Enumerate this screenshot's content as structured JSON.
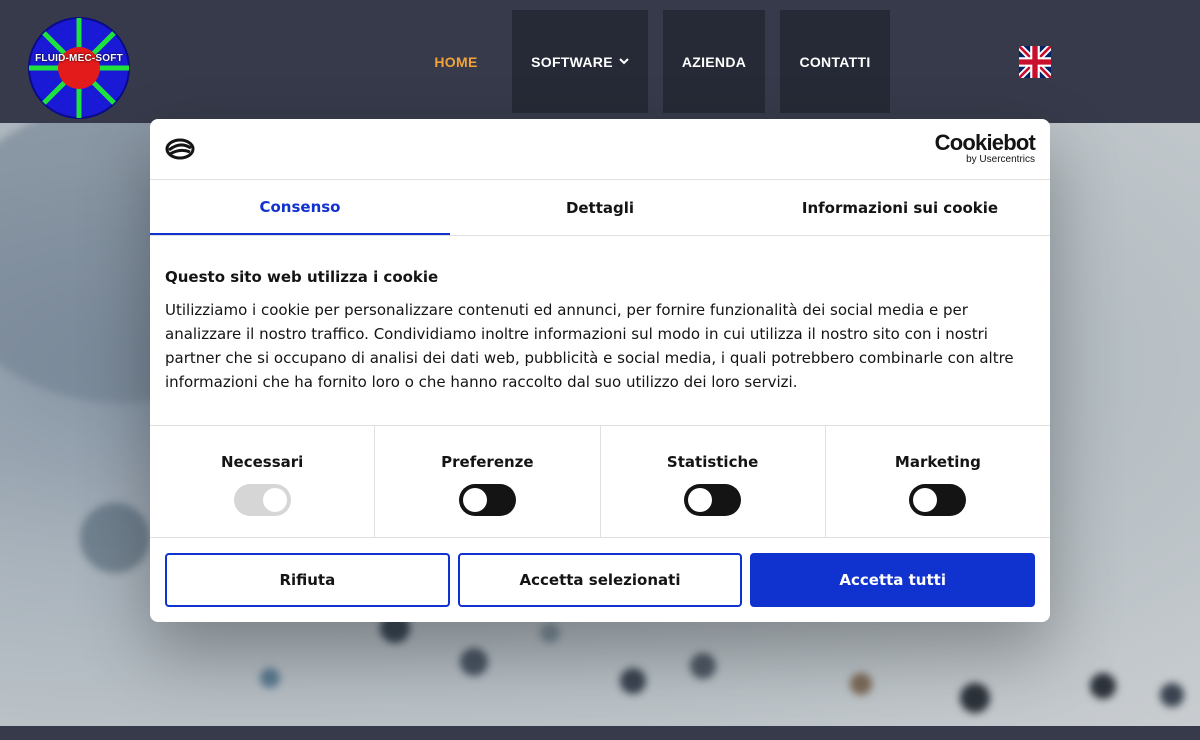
{
  "site": {
    "logo_text": "FLUID-MEC-SOFT",
    "nav": {
      "home": "HOME",
      "software": "SOFTWARE",
      "azienda": "AZIENDA",
      "contatti": "CONTATTI"
    }
  },
  "cookie_dialog": {
    "brand": {
      "name": "Cookiebot",
      "byline": "by Usercentrics"
    },
    "tabs": [
      {
        "label": "Consenso",
        "active": true
      },
      {
        "label": "Dettagli",
        "active": false
      },
      {
        "label": "Informazioni sui cookie",
        "active": false
      }
    ],
    "heading": "Questo sito web utilizza i cookie",
    "text": "Utilizziamo i cookie per personalizzare contenuti ed annunci, per fornire funzionalità dei social media e per analizzare il nostro traffico. Condividiamo inoltre informazioni sul modo in cui utilizza il nostro sito con i nostri partner che si occupano di analisi dei dati web, pubblicità e social media, i quali potrebbero combinarle con altre informazioni che ha fornito loro o che hanno raccolto dal suo utilizzo dei loro servizi.",
    "categories": [
      {
        "label": "Necessari",
        "checked": true,
        "disabled": true
      },
      {
        "label": "Preferenze",
        "checked": false,
        "disabled": false
      },
      {
        "label": "Statistiche",
        "checked": false,
        "disabled": false
      },
      {
        "label": "Marketing",
        "checked": false,
        "disabled": false
      }
    ],
    "buttons": {
      "reject": "Rifiuta",
      "accept_selected": "Accetta selezionati",
      "accept_all": "Accetta tutti"
    }
  },
  "colors": {
    "accent": "#1032cf",
    "header": "#363a4a",
    "nav_active": "#f2a33a"
  }
}
